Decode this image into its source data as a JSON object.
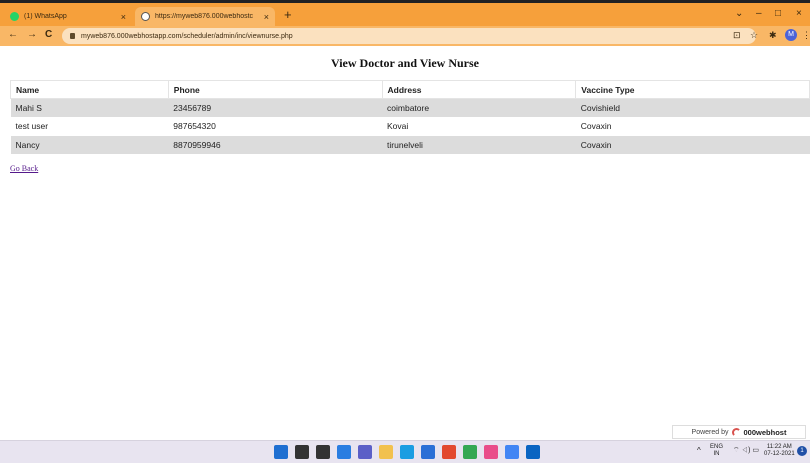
{
  "browser": {
    "tabs": [
      {
        "title": "(1) WhatsApp",
        "close": "×"
      },
      {
        "title": "https://myweb876.000webhostc",
        "close": "×"
      }
    ],
    "new_tab": "+",
    "window_controls": {
      "minimize": "⌄",
      "dash": "–",
      "maximize": "□",
      "close": "×"
    },
    "nav": {
      "back": "←",
      "forward": "→",
      "reload": "C"
    },
    "url": "myweb876.000webhostapp.com/scheduler/admin/inc/viewnurse.php",
    "profile_initial": "M",
    "toolbar_icons": {
      "share": "⊡",
      "star": "☆",
      "extensions": "✱",
      "menu": "⋮"
    }
  },
  "page": {
    "heading": "View Doctor and View Nurse",
    "table": {
      "headers": [
        "Name",
        "Phone",
        "Address",
        "Vaccine Type"
      ],
      "rows": [
        [
          "Mahi S",
          "23456789",
          "coimbatore",
          "Covishield"
        ],
        [
          "test user",
          "987654320",
          "Kovai",
          "Covaxin"
        ],
        [
          "Nancy",
          "8870959946",
          "tirunelveli",
          "Covaxin"
        ]
      ]
    },
    "go_back": "Go Back"
  },
  "badge": {
    "prefix": "Powered by",
    "brand": "000webhost"
  },
  "taskbar": {
    "icons": [
      {
        "name": "windows-start-icon",
        "color": "#1f6fd1"
      },
      {
        "name": "search-icon",
        "color": "#333333"
      },
      {
        "name": "task-view-icon",
        "color": "#333333"
      },
      {
        "name": "widgets-icon",
        "color": "#2a7de1"
      },
      {
        "name": "chat-icon",
        "color": "#5b5fc7"
      },
      {
        "name": "file-explorer-icon",
        "color": "#f2c14e"
      },
      {
        "name": "edge-icon",
        "color": "#1b9de2"
      },
      {
        "name": "store-icon",
        "color": "#2b6fd6"
      },
      {
        "name": "office-icon",
        "color": "#e2492f"
      },
      {
        "name": "chrome-icon",
        "color": "#34a853"
      },
      {
        "name": "snip-icon",
        "color": "#e94d8a"
      },
      {
        "name": "chrome-profile-icon",
        "color": "#4285f4"
      },
      {
        "name": "mail-icon",
        "color": "#0a64c2"
      }
    ],
    "tray_chevron": "^",
    "lang_top": "ENG",
    "lang_bottom": "IN",
    "status_icons": "⌔ ◁) ▭",
    "time": "11:22 AM",
    "date": "07-12-2021",
    "notification_count": "1"
  }
}
